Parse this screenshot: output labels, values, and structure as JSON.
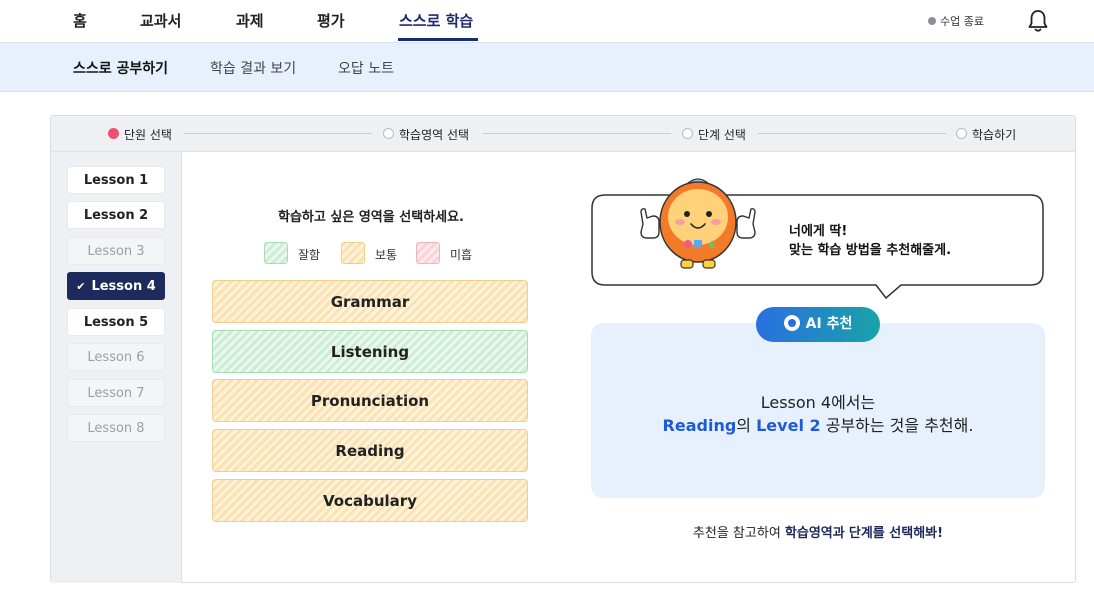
{
  "topnav": {
    "items": [
      "홈",
      "교과서",
      "과제",
      "평가",
      "스스로 학습"
    ],
    "active_index": 4,
    "end_class": "수업 종료",
    "bell_icon": "bell-icon"
  },
  "subnav": {
    "items": [
      "스스로 공부하기",
      "학습 결과 보기",
      "오답 노트"
    ],
    "active_index": 0
  },
  "steps": {
    "items": [
      "단원 선택",
      "학습영역 선택",
      "단계 선택",
      "학습하기"
    ],
    "current_index": 0
  },
  "lessons": {
    "items": [
      {
        "label": "Lesson 1",
        "state": "enabled"
      },
      {
        "label": "Lesson 2",
        "state": "enabled"
      },
      {
        "label": "Lesson 3",
        "state": "disabled"
      },
      {
        "label": "Lesson 4",
        "state": "selected"
      },
      {
        "label": "Lesson 5",
        "state": "enabled"
      },
      {
        "label": "Lesson 6",
        "state": "disabled"
      },
      {
        "label": "Lesson 7",
        "state": "disabled"
      },
      {
        "label": "Lesson 8",
        "state": "disabled"
      }
    ]
  },
  "areas": {
    "prompt": "학습하고 싶은 영역을 선택하세요.",
    "legend": {
      "good": "잘함",
      "average": "보통",
      "poor": "미흡"
    },
    "items": [
      {
        "label": "Grammar",
        "level": "average"
      },
      {
        "label": "Listening",
        "level": "good"
      },
      {
        "label": "Pronunciation",
        "level": "average"
      },
      {
        "label": "Reading",
        "level": "average"
      },
      {
        "label": "Vocabulary",
        "level": "average"
      }
    ]
  },
  "recommend": {
    "bubble_line1": "너에게 딱!",
    "bubble_line2": "맞는 학습 방법을 추천해줄게.",
    "badge": "AI 추천",
    "line1": "Lesson 4에서는",
    "area": "Reading",
    "particle": "의",
    "level": "Level 2",
    "line2_rest": "공부하는 것을 추천해.",
    "footer_pre": "추천을 참고하여",
    "footer_hl1": "학습영역",
    "footer_mid": "과",
    "footer_hl2": "단계",
    "footer_post": "를 선택해봐!"
  },
  "colors": {
    "accent_navy": "#1d2a5c",
    "highlight_blue": "#1f5bd6",
    "step_active": "#ef4f6e",
    "panel_bg": "#e7f1fd"
  }
}
